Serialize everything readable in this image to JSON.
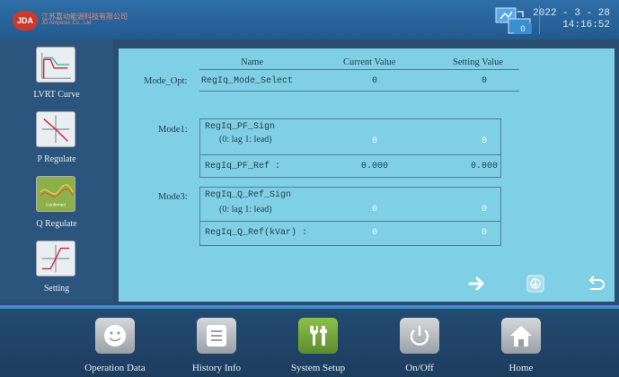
{
  "header": {
    "logo_badge": "JDA",
    "logo_cn": "江苏嘉动能源科技有限公司",
    "logo_en": "JD Amperes Co., Ltd",
    "net_badge": "0",
    "date": "2022 - 3 - 28",
    "time": "14:16:52"
  },
  "sidebar": {
    "items": [
      {
        "label": "LVRT Curve",
        "icon": "lvrt-curve-icon"
      },
      {
        "label": "P Regulate",
        "icon": "p-regulate-icon"
      },
      {
        "label": "Q Regulate",
        "icon": "q-regulate-icon",
        "badge": "Confirmed",
        "active": true
      },
      {
        "label": "Setting",
        "icon": "setting-icon"
      }
    ]
  },
  "table": {
    "col_name": "Name",
    "col_current": "Current Value",
    "col_setting": "Setting Value",
    "mode_opt": {
      "label": "Mode_Opt:",
      "name": "RegIq_Mode_Select",
      "current": "0",
      "setting": "0"
    },
    "mode1": {
      "label": "Mode1:",
      "r1_name": "RegIq_PF_Sign",
      "r1_hint": "(0: lag 1: lead)",
      "r1_current": "0",
      "r1_setting": "0",
      "r2_name": "RegIq_PF_Ref :",
      "r2_current": "0.000",
      "r2_setting": "0.000"
    },
    "mode3": {
      "label": "Mode3:",
      "r1_name": "RegIq_Q_Ref_Sign",
      "r1_hint": "(0: lag 1: lead)",
      "r1_current": "0",
      "r1_setting": "0",
      "r2_name": "RegIq_Q_Ref(kVar) :",
      "r2_current": "0",
      "r2_setting": "0"
    }
  },
  "nav": {
    "next": "arrow-right-icon",
    "download": "download-icon",
    "back": "return-icon"
  },
  "bottom": {
    "items": [
      {
        "label": "Operation Data",
        "icon": "operation-data-icon"
      },
      {
        "label": "History Info",
        "icon": "history-info-icon"
      },
      {
        "label": "System Setup",
        "icon": "system-setup-icon",
        "active": true
      },
      {
        "label": "On/Off",
        "icon": "power-icon"
      },
      {
        "label": "Home",
        "icon": "home-icon"
      }
    ]
  },
  "colors": {
    "header": "#2f6ea7",
    "panel": "#7fd0e5",
    "accent": "#3f8fd0",
    "active": "#8db14a"
  }
}
